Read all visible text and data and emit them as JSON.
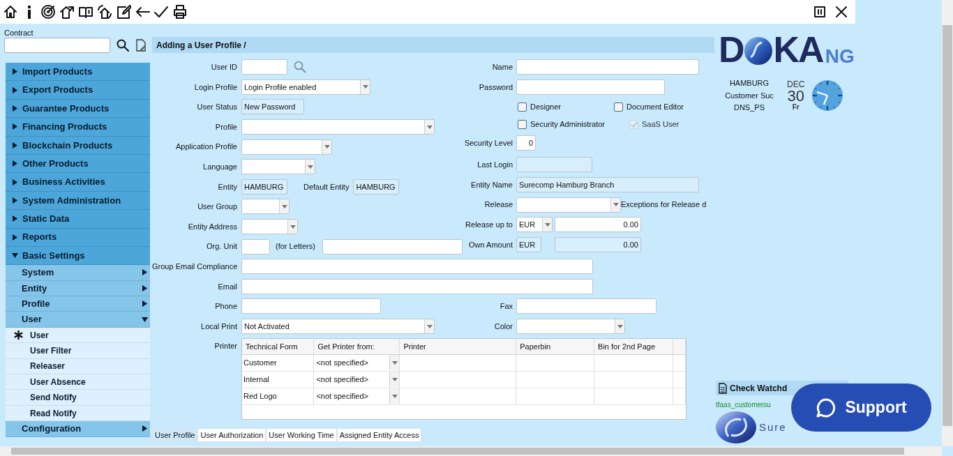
{
  "sidebar": {
    "contract_label": "Contract",
    "menu": [
      {
        "label": "Import Products",
        "expanded": false
      },
      {
        "label": "Export Products",
        "expanded": false
      },
      {
        "label": "Guarantee Products",
        "expanded": false
      },
      {
        "label": "Financing Products",
        "expanded": false
      },
      {
        "label": "Blockchain Products",
        "expanded": false
      },
      {
        "label": "Other Products",
        "expanded": false
      },
      {
        "label": "Business Activities",
        "expanded": false
      },
      {
        "label": "System Administration",
        "expanded": false
      },
      {
        "label": "Static Data",
        "expanded": false
      },
      {
        "label": "Reports",
        "expanded": false
      },
      {
        "label": "Basic Settings",
        "expanded": true,
        "children": [
          {
            "label": "System",
            "expanded": false
          },
          {
            "label": "Entity",
            "expanded": false
          },
          {
            "label": "Profile",
            "expanded": false
          },
          {
            "label": "User",
            "expanded": true,
            "children": [
              {
                "label": "User",
                "selected": true
              },
              {
                "label": "User Filter",
                "selected": false
              },
              {
                "label": "Releaser",
                "selected": false
              },
              {
                "label": "User Absence",
                "selected": false
              },
              {
                "label": "Send Notify",
                "selected": false
              },
              {
                "label": "Read Notify",
                "selected": false
              }
            ]
          },
          {
            "label": "Configuration",
            "expanded": false
          }
        ]
      }
    ]
  },
  "header": "Adding a User Profile /",
  "form": {
    "left": [
      {
        "label": "User ID",
        "controls": [
          {
            "kind": "text"
          },
          {
            "kind": "search"
          }
        ]
      },
      {
        "label": "Login Profile",
        "controls": [
          {
            "kind": "select",
            "value": "Login Profile enabled"
          }
        ]
      },
      {
        "label": "User Status",
        "controls": [
          {
            "kind": "readonly",
            "value": "New Password"
          }
        ]
      },
      {
        "label": "Profile",
        "controls": [
          {
            "kind": "select"
          }
        ]
      },
      {
        "label": "Application Profile",
        "controls": [
          {
            "kind": "select"
          }
        ]
      },
      {
        "label": "Language",
        "controls": [
          {
            "kind": "select"
          }
        ]
      },
      {
        "label": "Entity",
        "controls": [
          {
            "kind": "readonly",
            "value": "HAMBURG"
          },
          {
            "kind": "label",
            "text": "Default Entity"
          },
          {
            "kind": "readonly",
            "value": "HAMBURG"
          }
        ]
      },
      {
        "label": "User Group",
        "controls": [
          {
            "kind": "select"
          }
        ]
      },
      {
        "label": "Entity Address",
        "controls": [
          {
            "kind": "select"
          }
        ]
      },
      {
        "label": "Org. Unit",
        "controls": [
          {
            "kind": "text"
          },
          {
            "kind": "label",
            "text": "(for Letters)"
          },
          {
            "kind": "text"
          }
        ]
      }
    ],
    "right": [
      {
        "label": "Name",
        "controls": [
          {
            "kind": "text"
          }
        ]
      },
      {
        "label": "Password",
        "controls": [
          {
            "kind": "text"
          }
        ]
      },
      {
        "controls": [
          {
            "kind": "checkbox",
            "text": "Designer",
            "checked": false,
            "disabled": false
          },
          {
            "kind": "checkbox",
            "text": "Document Editor",
            "checked": false,
            "disabled": false
          }
        ]
      },
      {
        "controls": [
          {
            "kind": "checkbox",
            "text": "Security Administrator",
            "checked": false,
            "disabled": false
          },
          {
            "kind": "checkbox",
            "text": "SaaS User",
            "checked": true,
            "disabled": true
          }
        ]
      },
      {
        "label": "Security Level",
        "controls": [
          {
            "kind": "amount",
            "value": "0"
          }
        ]
      },
      {
        "label": "Last Login",
        "controls": [
          {
            "kind": "readonly"
          }
        ]
      },
      {
        "label": "Entity Name",
        "controls": [
          {
            "kind": "readonly",
            "value": "Surecomp Hamburg Branch"
          }
        ]
      },
      {
        "label": "Release",
        "controls": [
          {
            "kind": "select"
          },
          {
            "kind": "label",
            "text": "Exceptions for Release d"
          }
        ]
      },
      {
        "label": "Release up to",
        "controls": [
          {
            "kind": "select",
            "value": "EUR"
          },
          {
            "kind": "amount",
            "value": "0.00"
          }
        ]
      },
      {
        "label": "Own Amount",
        "controls": [
          {
            "kind": "readonly",
            "value": "EUR"
          },
          {
            "kind": "readonly_amount",
            "value": "0.00"
          }
        ]
      }
    ],
    "wide": [
      {
        "label": "Group Email Compliance",
        "controls": [
          {
            "kind": "text"
          }
        ]
      },
      {
        "label": "Email",
        "controls": [
          {
            "kind": "text"
          }
        ]
      }
    ],
    "pairs": [
      {
        "left": {
          "label": "Phone",
          "controls": [
            {
              "kind": "text"
            }
          ]
        },
        "right": {
          "label": "Fax",
          "controls": [
            {
              "kind": "text"
            }
          ]
        }
      },
      {
        "left": {
          "label": "Local Print",
          "controls": [
            {
              "kind": "select",
              "value": "Not Activated"
            }
          ]
        },
        "right": {
          "label": "Color",
          "controls": [
            {
              "kind": "select"
            }
          ]
        }
      }
    ],
    "printer": {
      "label": "Printer",
      "columns": [
        "Technical Form",
        "Get Printer from:",
        "Printer",
        "Paperbin",
        "Bin for 2nd Page"
      ],
      "rows": [
        {
          "technical_form": "Customer",
          "get_printer_from": "<not specified>"
        },
        {
          "technical_form": "Internal",
          "get_printer_from": "<not specified>"
        },
        {
          "technical_form": "Red Logo",
          "get_printer_from": "<not specified>"
        }
      ]
    }
  },
  "tabs": [
    {
      "label": "User Profile",
      "selected": true
    },
    {
      "label": "User Authorization",
      "selected": false
    },
    {
      "label": "User Working Time",
      "selected": false
    },
    {
      "label": "Assigned Entity Access",
      "selected": false
    }
  ],
  "brand": {
    "logo_before": "D",
    "logo_after": "KA",
    "logo_suffix": "NG",
    "info": [
      "HAMBURG",
      "Customer Suc",
      "DNS_PS"
    ],
    "date": {
      "month": "DEC",
      "day": "30",
      "weekday": "Fr"
    }
  },
  "watchdog": {
    "label": "Check Watchd",
    "user": "tfaas_customersu",
    "company": "Sure"
  },
  "support": {
    "label": "Support"
  }
}
